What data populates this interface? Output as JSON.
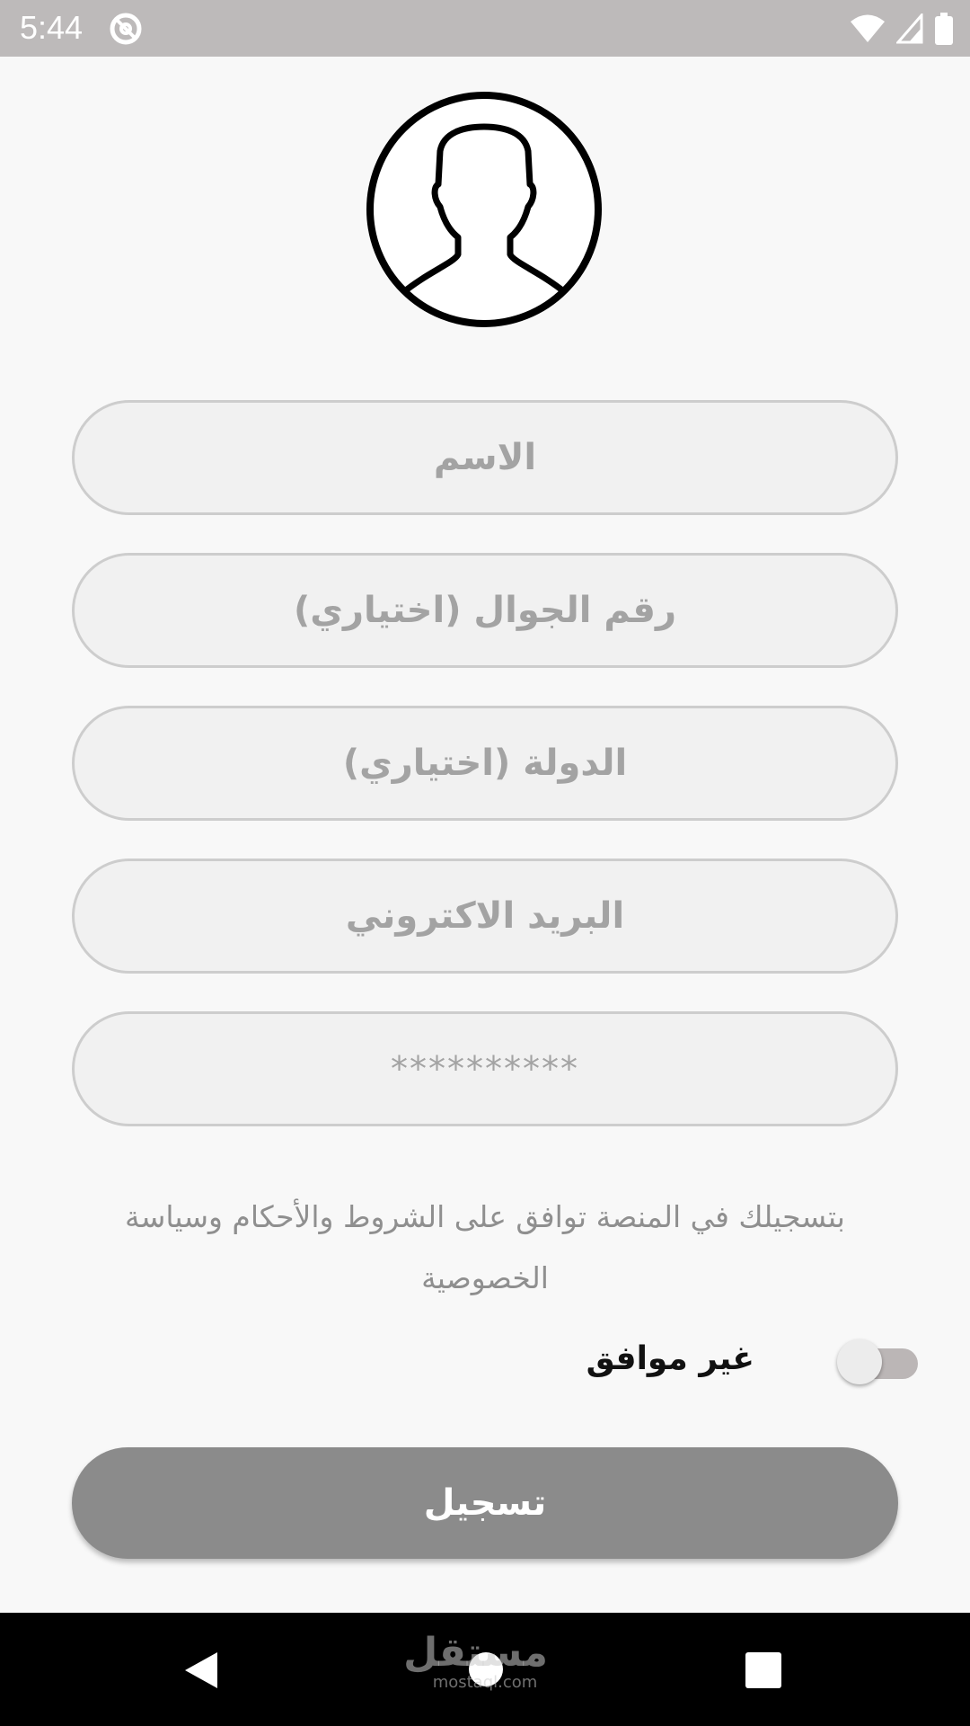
{
  "status_bar": {
    "time": "5:44",
    "icons": [
      "at-sign-icon",
      "wifi-icon",
      "cell-signal-icon",
      "battery-icon"
    ]
  },
  "avatar": {
    "icon": "user-silhouette-icon"
  },
  "form": {
    "name_placeholder": "الاسم",
    "phone_placeholder": "رقم الجوال (اختياري)",
    "country_placeholder": "الدولة (اختياري)",
    "email_placeholder": "البريد الاكتروني",
    "password_placeholder": "**********"
  },
  "terms_text": "بتسجيلك في المنصة توافق على الشروط والأحكام وسياسة الخصوصية",
  "agreement": {
    "label": "غير موافق",
    "toggle_on": false
  },
  "register_button": {
    "label": "تسجيل"
  },
  "nav_bar": {
    "watermark_main": "مستقل",
    "watermark_sub": "mostaql.com"
  },
  "colors": {
    "status_bar_bg": "#bdbaba",
    "field_bg": "#f1f1f1",
    "field_border": "#cdcdcd",
    "button_bg": "#8b8b8b",
    "placeholder_text": "#a3a3a3"
  }
}
